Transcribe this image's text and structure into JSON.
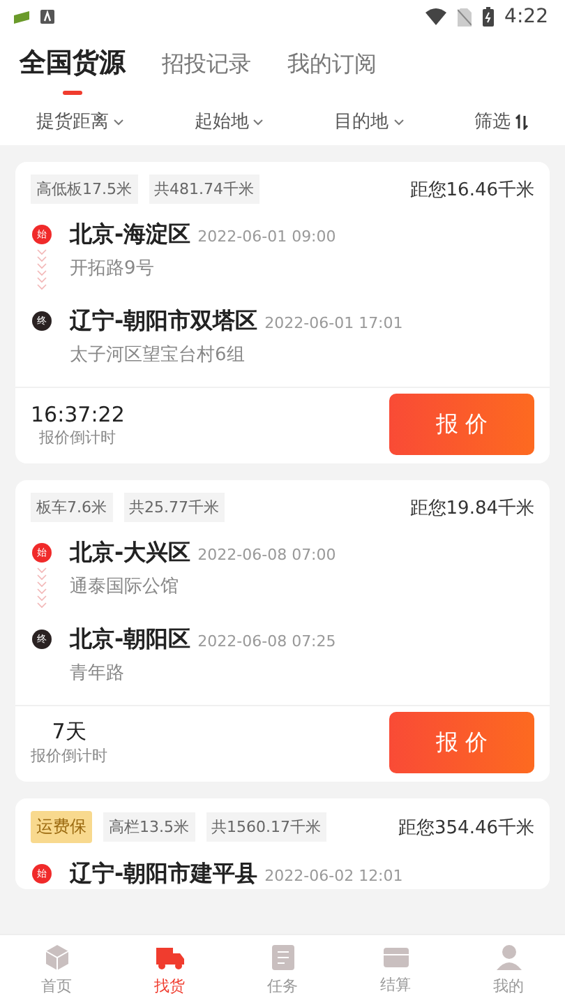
{
  "status_bar": {
    "time": "4:22"
  },
  "tabs": [
    {
      "label": "全国货源",
      "selected": true
    },
    {
      "label": "招投记录",
      "selected": false
    },
    {
      "label": "我的订阅",
      "selected": false
    }
  ],
  "filters": [
    {
      "label": "提货距离",
      "kind": "dropdown"
    },
    {
      "label": "起始地",
      "kind": "dropdown"
    },
    {
      "label": "目的地",
      "kind": "dropdown"
    },
    {
      "label": "筛选",
      "kind": "sort"
    }
  ],
  "cards": [
    {
      "tags": [
        {
          "text": "高低板17.5米",
          "kind": "plain"
        },
        {
          "text": "共481.74千米",
          "kind": "plain"
        }
      ],
      "distance": "距您16.46千米",
      "origin": {
        "mark": "始",
        "city": "北京-海淀区",
        "time": "2022-06-01 09:00",
        "address": "开拓路9号"
      },
      "destination": {
        "mark": "终",
        "city": "辽宁-朝阳市双塔区",
        "time": "2022-06-01 17:01",
        "address": "太子河区望宝台村6组"
      },
      "countdown": "16:37:22",
      "countdown_label": "报价倒计时",
      "button": "报 价"
    },
    {
      "tags": [
        {
          "text": "板车7.6米",
          "kind": "plain"
        },
        {
          "text": "共25.77千米",
          "kind": "plain"
        }
      ],
      "distance": "距您19.84千米",
      "origin": {
        "mark": "始",
        "city": "北京-大兴区",
        "time": "2022-06-08 07:00",
        "address": "通泰国际公馆"
      },
      "destination": {
        "mark": "终",
        "city": "北京-朝阳区",
        "time": "2022-06-08 07:25",
        "address": "青年路"
      },
      "countdown": "7天",
      "countdown_label": "报价倒计时",
      "button": "报 价"
    },
    {
      "tags": [
        {
          "text": "运费保",
          "kind": "insurance"
        },
        {
          "text": "高栏13.5米",
          "kind": "plain"
        },
        {
          "text": "共1560.17千米",
          "kind": "plain"
        }
      ],
      "distance": "距您354.46千米",
      "origin": {
        "mark": "始",
        "city": "辽宁-朝阳市建平县",
        "time": "2022-06-02 12:01"
      }
    }
  ],
  "bottom_nav": [
    {
      "label": "首页",
      "kind": "home",
      "selected": false
    },
    {
      "label": "找货",
      "kind": "truck",
      "selected": true
    },
    {
      "label": "任务",
      "kind": "task",
      "selected": false
    },
    {
      "label": "结算",
      "kind": "settle",
      "selected": false
    },
    {
      "label": "我的",
      "kind": "user",
      "selected": false
    }
  ]
}
